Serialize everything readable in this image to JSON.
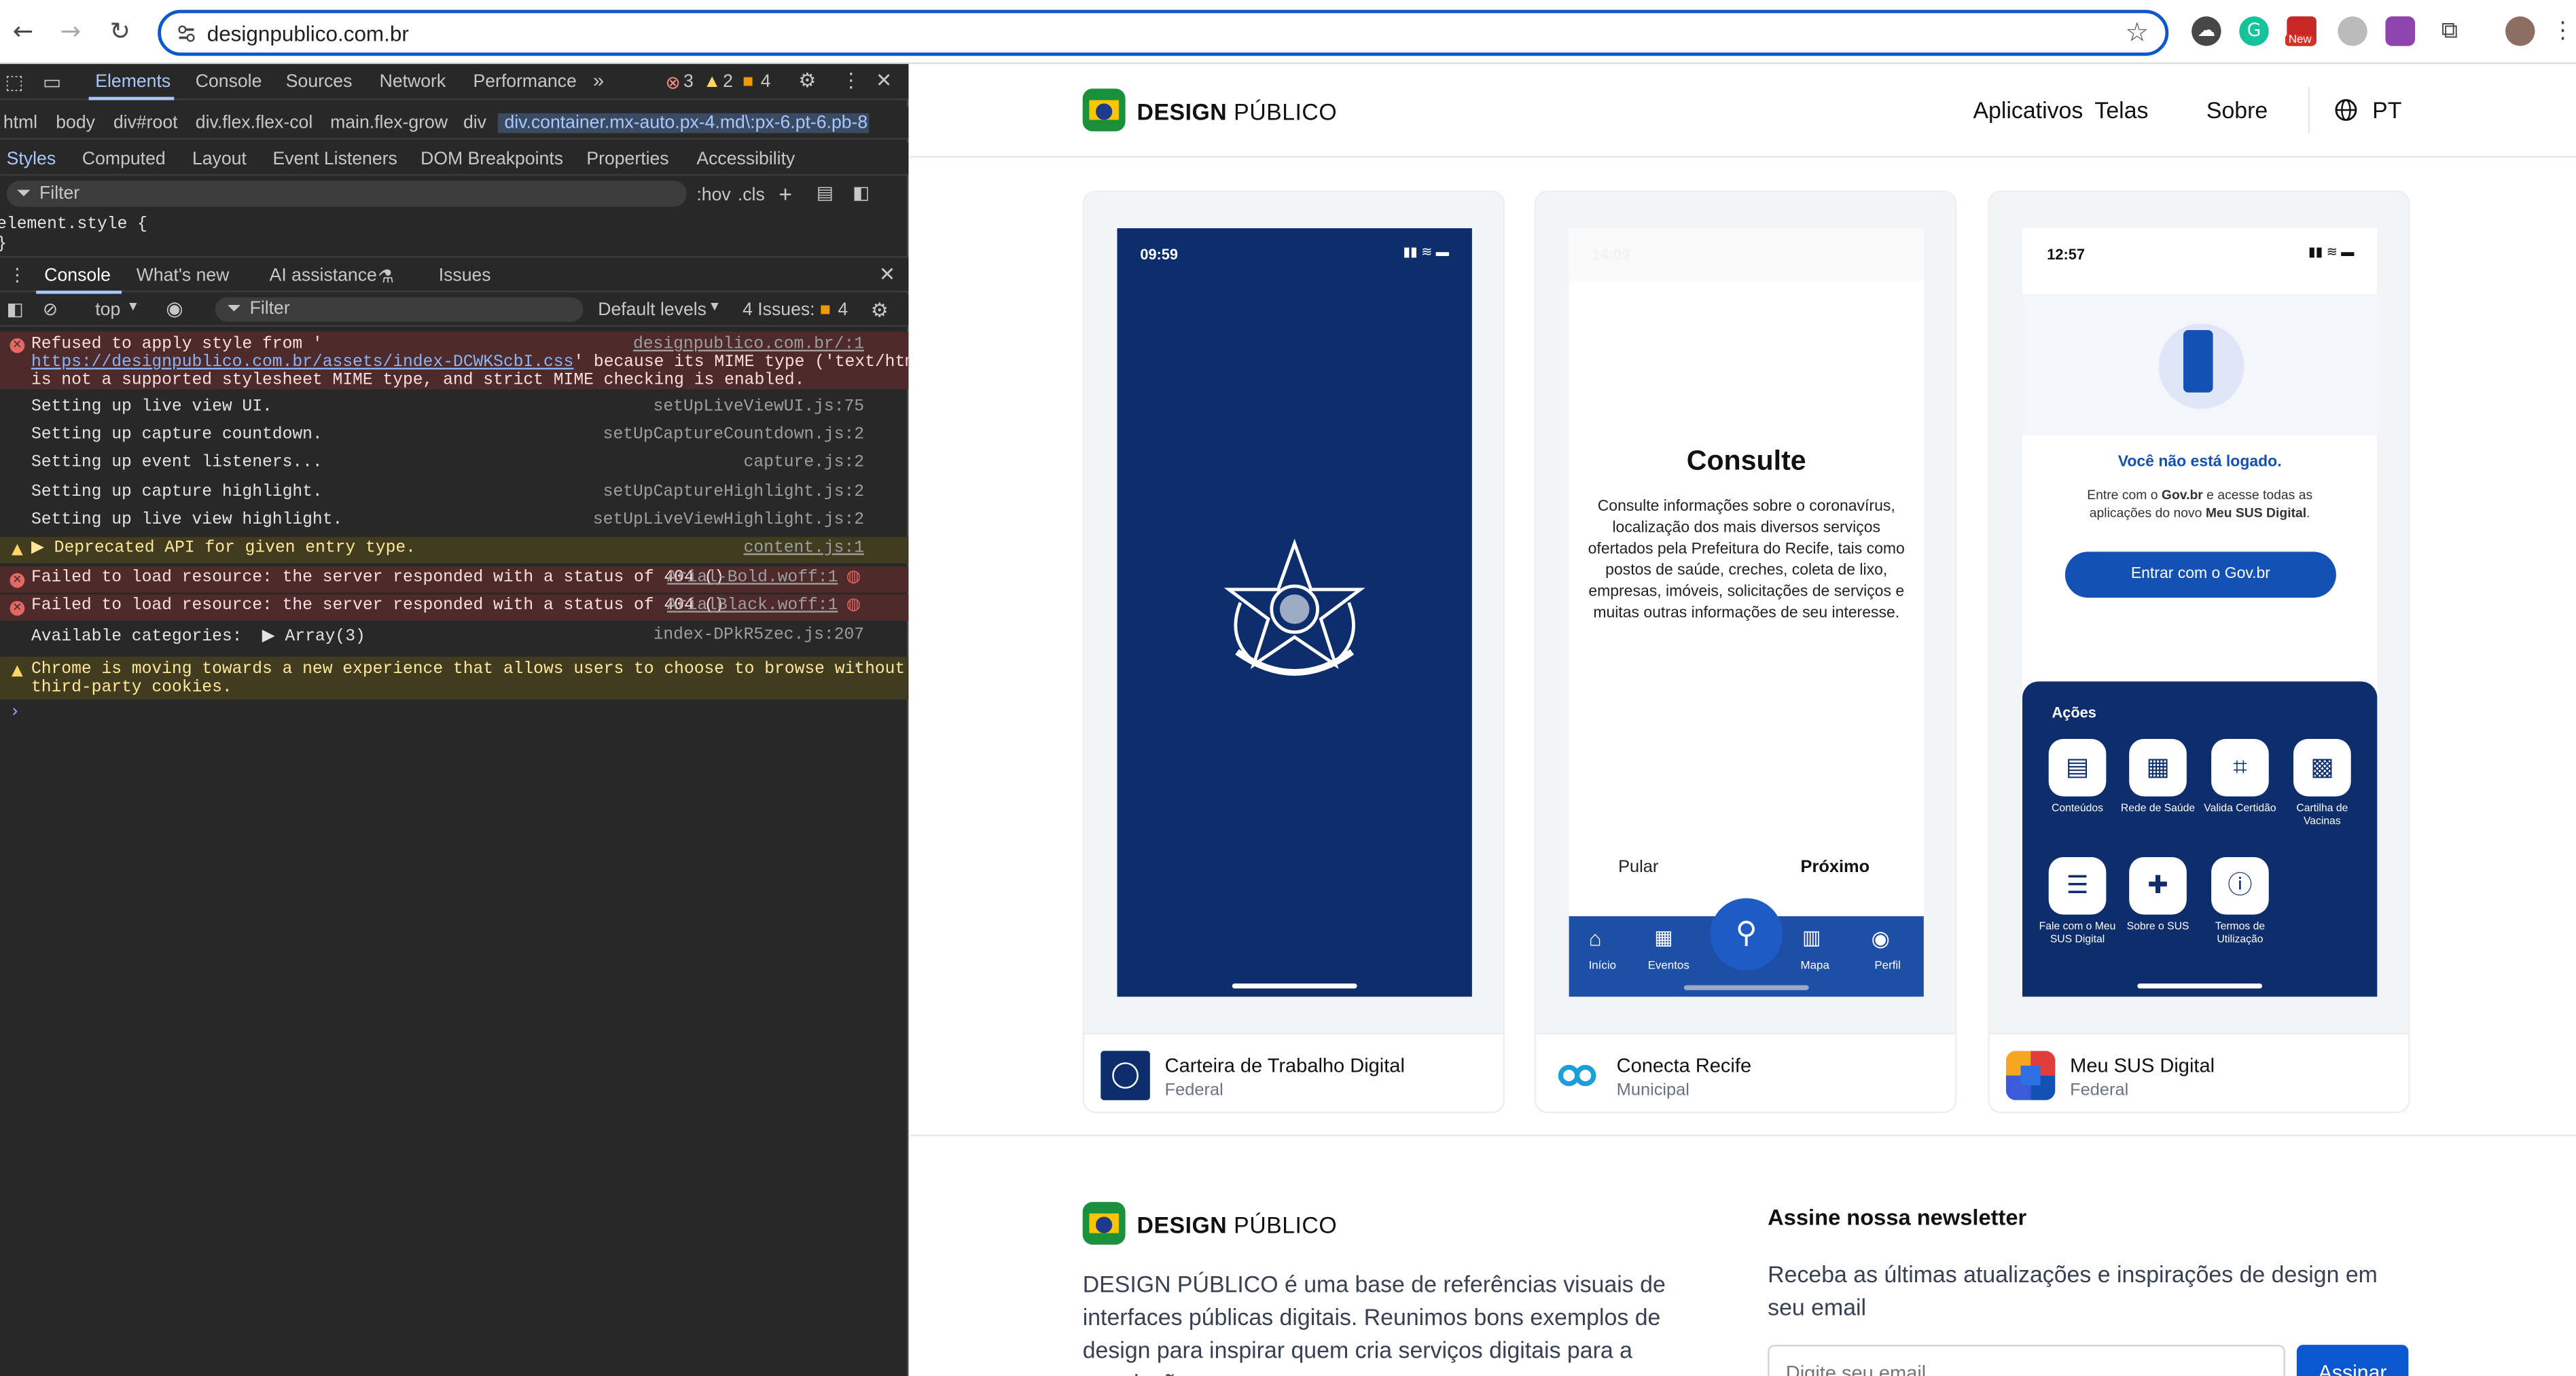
{
  "browser": {
    "url": "designpublico.com.br",
    "toolbar_badge": "New"
  },
  "devtools": {
    "main_tabs": [
      "Elements",
      "Console",
      "Sources",
      "Network",
      "Performance"
    ],
    "counts": {
      "errors": "3",
      "warnings": "2",
      "issues": "4"
    },
    "breadcrumbs": [
      "html",
      "body",
      "div#root",
      "div.flex.flex-col",
      "main.flex-grow",
      "div",
      "div.container.mx-auto.px-4.md\\:px-6.pt-6.pb-8"
    ],
    "style_tabs": [
      "Styles",
      "Computed",
      "Layout",
      "Event Listeners",
      "DOM Breakpoints",
      "Properties",
      "Accessibility"
    ],
    "filter_placeholder": "Filter",
    "hov": ":hov",
    "cls": ".cls",
    "element_style": "element.style {",
    "element_style_close": "}",
    "drawer_tabs": [
      "Console",
      "What's new",
      "AI assistance",
      "Issues"
    ],
    "context": "top",
    "console_filter": "Filter",
    "levels": "Default levels",
    "issues_label": "4 Issues:",
    "issues_count": "4",
    "messages": [
      {
        "type": "error",
        "l1": "Refused to apply style from '",
        "link": "https://designpublico.com.br/assets/index-DCWKScbI.css",
        "l2": "' because its MIME type ('text/html')",
        "l3": "is not a supported stylesheet MIME type, and strict MIME checking is enabled.",
        "src": "designpublico.com.br/:1"
      },
      {
        "type": "log",
        "text": "Setting up live view UI.",
        "src": "setUpLiveViewUI.js:75"
      },
      {
        "type": "log",
        "text": "Setting up capture countdown.",
        "src": "setUpCaptureCountdown.js:2"
      },
      {
        "type": "log",
        "text": "Setting up event listeners...",
        "src": "capture.js:2"
      },
      {
        "type": "log",
        "text": "Setting up capture highlight.",
        "src": "setUpCaptureHighlight.js:2"
      },
      {
        "type": "log",
        "text": "Setting up live view highlight.",
        "src": "setUpLiveViewHighlight.js:2"
      },
      {
        "type": "warn",
        "text": "▶ Deprecated API for given entry type.",
        "src": "content.js:1"
      },
      {
        "type": "error",
        "text": "Failed to load resource: the server responded with a status of 404 ()",
        "src": "Arial-Bold.woff:1"
      },
      {
        "type": "error",
        "text": "Failed to load resource: the server responded with a status of 404 ()",
        "src": "ArialBlack.woff:1"
      },
      {
        "type": "log",
        "text": "Available categories:",
        "extra": "▶ Array(3)",
        "src": "index-DPkR5zec.js:207"
      },
      {
        "type": "warn",
        "l1": "Chrome is moving towards a new experience that allows users to choose to browse without",
        "l2": "third-party cookies."
      }
    ],
    "prompt": "›"
  },
  "site": {
    "brand_bold": "DESIGN",
    "brand_light": "PÚBLICO",
    "nav": [
      "Aplicativos",
      "Telas",
      "Sobre"
    ],
    "lang": "PT",
    "cards": [
      {
        "title": "Carteira de Trabalho Digital",
        "scope": "Federal",
        "phone": {
          "time": "09:59"
        }
      },
      {
        "title": "Conecta Recife",
        "scope": "Municipal",
        "phone": {
          "time": "14:09",
          "heading": "Consulte",
          "body": "Consulte informações sobre o coronavírus, localização dos mais diversos serviços ofertados pela Prefeitura do Recife, tais como postos de saúde, creches, coleta de lixo, empresas, imóveis, solicitações de serviços e muitas outras informações de seu interesse.",
          "skip": "Pular",
          "next": "Próximo",
          "tabs": [
            "Início",
            "Eventos",
            "Mapa",
            "Perfil"
          ]
        }
      },
      {
        "title": "Meu SUS Digital",
        "scope": "Federal",
        "phone": {
          "time": "12:57",
          "notice": "Você não está logado.",
          "desc1": "Entre com o ",
          "desc_b1": "Gov.br",
          "desc2": " e acesse todas as aplicações do novo ",
          "desc_b2": "Meu SUS Digital",
          "desc3": ".",
          "button": "Entrar com o Gov.br",
          "actions_title": "Ações",
          "actions": [
            "Conteúdos",
            "Rede de Saúde",
            "Valida Certidão",
            "Cartilha de Vacinas",
            "Fale com o Meu SUS Digital",
            "Sobre o SUS",
            "Termos de Utilização"
          ]
        }
      }
    ],
    "footer": {
      "about": "DESIGN PÚBLICO é uma base de referências visuais de interfaces públicas digitais. Reunimos bons exemplos de design para inspirar quem cria serviços digitais para a população.",
      "newsletter_title": "Assine nossa newsletter",
      "newsletter_desc": "Receba as últimas atualizações e inspirações de design em seu email",
      "email_placeholder": "Digite seu email",
      "subscribe": "Assinar"
    }
  },
  "colors": {
    "accent": "#0b57d0",
    "navy": "#0d2d6c",
    "sus_blue": "#1351b4"
  }
}
